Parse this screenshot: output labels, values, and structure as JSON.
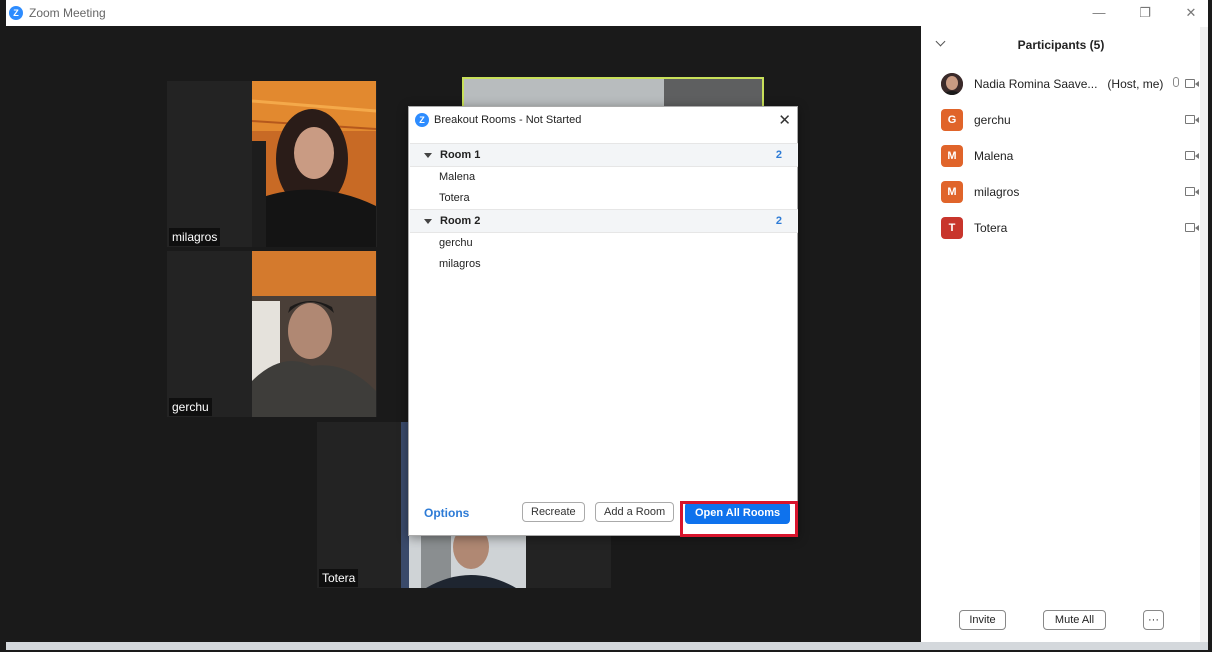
{
  "window": {
    "title": "Zoom Meeting",
    "logo_glyph": "Z",
    "minimize": "—",
    "restore": "❐",
    "close": "✕"
  },
  "videos": {
    "tiles": [
      {
        "name": "milagros"
      },
      {
        "name": "gerchu"
      },
      {
        "name": "Totera"
      }
    ]
  },
  "breakout": {
    "logo_glyph": "Z",
    "title": "Breakout Rooms - Not Started",
    "close": "✕",
    "rooms": [
      {
        "name": "Room 1",
        "count": "2",
        "members": [
          "Malena",
          "Totera"
        ]
      },
      {
        "name": "Room 2",
        "count": "2",
        "members": [
          "gerchu",
          "milagros"
        ]
      }
    ],
    "options_label": "Options",
    "recreate_label": "Recreate",
    "add_room_label": "Add a Room",
    "open_all_label": "Open All Rooms"
  },
  "participants": {
    "title": "Participants (5)",
    "list": [
      {
        "name": "Nadia Romina Saave...",
        "role": "(Host, me)",
        "initial": "",
        "color": "#5a3b3a"
      },
      {
        "name": "gerchu",
        "role": "",
        "initial": "G",
        "color": "#e0642a"
      },
      {
        "name": "Malena",
        "role": "",
        "initial": "M",
        "color": "#e0642a"
      },
      {
        "name": "milagros",
        "role": "",
        "initial": "M",
        "color": "#e0642a"
      },
      {
        "name": "Totera",
        "role": "",
        "initial": "T",
        "color": "#c8352c"
      }
    ],
    "invite_label": "Invite",
    "mute_all_label": "Mute All",
    "more_label": "···"
  },
  "colors": {
    "accent": "#0e72ed",
    "link": "#2d7bd6",
    "highlight": "#d8142c",
    "video_bg": "#1a1a1a"
  }
}
